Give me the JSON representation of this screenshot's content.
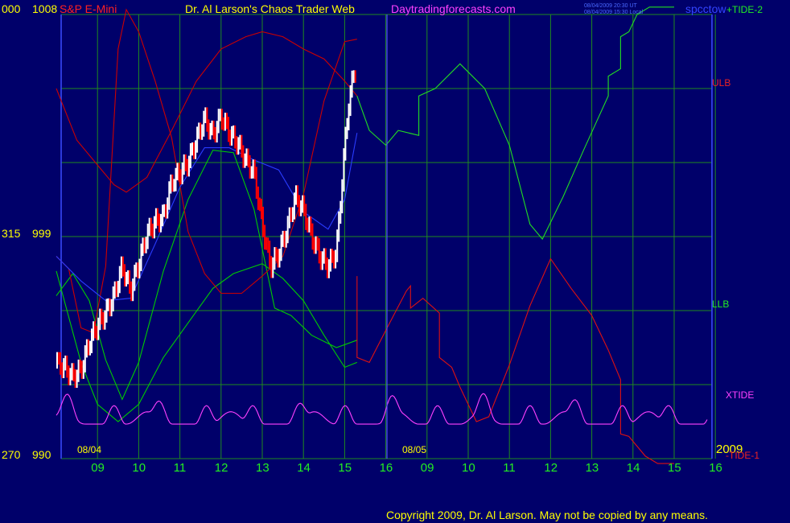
{
  "header": {
    "left_value": "000",
    "top_price": "1008",
    "symbol": "S&P E-Mini",
    "title": "Dr. Al Larson's Chaos Trader Web",
    "site": "Daytradingforecasts.com",
    "timestamp_utc": "08/04/2009 20:30 UT",
    "timestamp_local": "08/04/2009 15:30 Local",
    "ticker": "spcctow"
  },
  "right_labels": {
    "tide2": "+TIDE-2",
    "ulb": "ULB",
    "llb": "LLB",
    "xtide": "XTIDE",
    "year": "2009",
    "tide1": "-TIDE-1"
  },
  "left_labels": {
    "mid_left": "315",
    "mid_price": "999",
    "bottom_left": "270",
    "bottom_price": "990"
  },
  "date_labels": {
    "day1": "08/04",
    "day2": "08/05"
  },
  "footer": {
    "copyright": "Copyright 2009, Dr. Al Larson. May not be copied by any means."
  },
  "colors": {
    "background": "#00006a",
    "grid": "#1f8a1f",
    "price_up": "#ffffff",
    "price_down": "#ff0000",
    "ma_yellow": "#ffff00",
    "ma_blue": "#2a3cff",
    "band_red": "#cc0000",
    "band_green": "#00cc00",
    "xtide": "#ff40ff",
    "tide2": "#22dd22",
    "tide1": "#dd1111",
    "axis_text": "#ffff00",
    "hour_text": "#22ee22",
    "marker": "#5050ff"
  },
  "chart_data": {
    "type": "line",
    "xlabel": "",
    "ylabel": "",
    "y_axis_ticks": [
      990,
      999,
      1008
    ],
    "ylim": [
      990,
      1008
    ],
    "x_hours": [
      "09",
      "10",
      "11",
      "12",
      "13",
      "14",
      "15",
      "16",
      "09",
      "10",
      "11",
      "12",
      "13",
      "14",
      "15",
      "16"
    ],
    "grid": true,
    "price_path": [
      [
        0,
        993.9
      ],
      [
        0.2,
        993.7
      ],
      [
        0.4,
        993.3
      ],
      [
        0.6,
        993.6
      ],
      [
        0.8,
        994.7
      ],
      [
        1.0,
        995.4
      ],
      [
        1.2,
        995.9
      ],
      [
        1.4,
        996.6
      ],
      [
        1.6,
        997.8
      ],
      [
        1.8,
        996.8
      ],
      [
        2.0,
        997.9
      ],
      [
        2.2,
        999.1
      ],
      [
        2.4,
        999.6
      ],
      [
        2.6,
        999.8
      ],
      [
        2.8,
        1001.2
      ],
      [
        3.0,
        1001.6
      ],
      [
        3.2,
        1002.0
      ],
      [
        3.4,
        1002.9
      ],
      [
        3.6,
        1003.8
      ],
      [
        3.8,
        1003.1
      ],
      [
        4.0,
        1003.9
      ],
      [
        4.2,
        1003.2
      ],
      [
        4.4,
        1002.8
      ],
      [
        4.6,
        1002.1
      ],
      [
        4.8,
        1001.6
      ],
      [
        5.0,
        999.5
      ],
      [
        5.2,
        997.8
      ],
      [
        5.4,
        998.3
      ],
      [
        5.6,
        999.3
      ],
      [
        5.8,
        1000.6
      ],
      [
        6.0,
        1000.1
      ],
      [
        6.2,
        999.0
      ],
      [
        6.4,
        998.2
      ],
      [
        6.6,
        997.8
      ],
      [
        6.8,
        998.4
      ],
      [
        6.9,
        1000.4
      ],
      [
        7.0,
        1002.6
      ],
      [
        7.1,
        1004.4
      ],
      [
        7.2,
        1005.4
      ],
      [
        7.3,
        1006.0
      ]
    ],
    "series": [
      {
        "name": "ULB",
        "color": "#cc0000",
        "points": [
          [
            0,
            1005.0
          ],
          [
            0.5,
            1002.9
          ],
          [
            1.0,
            1001.9
          ],
          [
            1.4,
            1001.1
          ],
          [
            1.7,
            1000.8
          ],
          [
            2.2,
            1001.4
          ],
          [
            2.8,
            1003.3
          ],
          [
            3.4,
            1005.3
          ],
          [
            4.0,
            1006.6
          ],
          [
            4.6,
            1007.1
          ],
          [
            5.0,
            1007.3
          ],
          [
            5.5,
            1007.1
          ],
          [
            6.0,
            1006.6
          ],
          [
            6.5,
            1006.2
          ],
          [
            7.0,
            1005.3
          ],
          [
            7.3,
            1004.7
          ]
        ]
      },
      {
        "name": "LLB",
        "color": "#00cc00",
        "points": [
          [
            0,
            997.6
          ],
          [
            0.6,
            993.9
          ],
          [
            1.0,
            992.2
          ],
          [
            1.5,
            991.5
          ],
          [
            2.0,
            992.2
          ],
          [
            2.6,
            994.1
          ],
          [
            3.2,
            995.5
          ],
          [
            3.8,
            996.9
          ],
          [
            4.3,
            997.5
          ],
          [
            5.0,
            997.9
          ],
          [
            5.5,
            997.3
          ],
          [
            6.0,
            996.4
          ],
          [
            6.5,
            995.0
          ],
          [
            7.0,
            993.7
          ],
          [
            7.3,
            993.9
          ]
        ]
      },
      {
        "name": "",
        "color": "#00cc00",
        "points": [
          [
            0,
            996.6
          ],
          [
            0.4,
            997.5
          ],
          [
            0.8,
            996.4
          ],
          [
            1.2,
            994.0
          ],
          [
            1.6,
            992.4
          ],
          [
            2.0,
            993.9
          ],
          [
            2.6,
            997.6
          ],
          [
            3.2,
            1000.5
          ],
          [
            3.8,
            1002.5
          ],
          [
            4.3,
            1002.4
          ],
          [
            4.8,
            1000.1
          ],
          [
            5.3,
            996.1
          ],
          [
            5.7,
            995.8
          ],
          [
            6.2,
            995.0
          ],
          [
            6.8,
            994.5
          ],
          [
            7.3,
            994.8
          ]
        ]
      },
      {
        "name": "",
        "color": "#cc0000",
        "points": [
          [
            0,
            998.2
          ],
          [
            0.3,
            997.7
          ],
          [
            0.6,
            995.3
          ],
          [
            0.9,
            995.1
          ],
          [
            1.2,
            997.8
          ],
          [
            1.5,
            1006.6
          ],
          [
            1.7,
            1008.2
          ],
          [
            2.0,
            1007.3
          ],
          [
            2.4,
            1005.3
          ],
          [
            2.8,
            1003.0
          ],
          [
            3.2,
            999.2
          ],
          [
            3.6,
            997.5
          ],
          [
            4.0,
            996.7
          ],
          [
            4.5,
            996.7
          ],
          [
            5.0,
            997.4
          ],
          [
            5.5,
            998.2
          ],
          [
            6.0,
            1000.7
          ],
          [
            6.5,
            1004.5
          ],
          [
            7.0,
            1006.9
          ],
          [
            7.3,
            1007.0
          ]
        ]
      },
      {
        "name": "",
        "color": "#2a3cff",
        "points": [
          [
            0,
            998.2
          ],
          [
            0.6,
            997.2
          ],
          [
            1.2,
            996.4
          ],
          [
            1.8,
            996.5
          ],
          [
            2.4,
            998.7
          ],
          [
            3.0,
            1001.0
          ],
          [
            3.6,
            1002.6
          ],
          [
            4.2,
            1002.6
          ],
          [
            4.8,
            1002.1
          ],
          [
            5.4,
            1001.7
          ],
          [
            6.0,
            1000.0
          ],
          [
            6.6,
            999.3
          ],
          [
            7.0,
            1000.5
          ],
          [
            7.3,
            1003.2
          ]
        ]
      },
      {
        "name": "+TIDE-2",
        "color": "#22dd22",
        "points": [
          [
            7.3,
            1004.7
          ],
          [
            7.6,
            1003.3
          ],
          [
            8.0,
            1002.7
          ],
          [
            8.3,
            1003.3
          ],
          [
            8.8,
            1003.1
          ],
          [
            8.8,
            1004.7
          ],
          [
            9.2,
            1005.0
          ],
          [
            9.8,
            1006.0
          ],
          [
            10.4,
            1005.0
          ],
          [
            11.0,
            1002.7
          ],
          [
            11.5,
            999.5
          ],
          [
            11.8,
            998.9
          ],
          [
            12.3,
            1000.6
          ],
          [
            12.8,
            1002.5
          ],
          [
            13.4,
            1004.7
          ],
          [
            13.4,
            1005.5
          ],
          [
            13.7,
            1005.8
          ],
          [
            13.7,
            1007.1
          ],
          [
            13.9,
            1007.3
          ],
          [
            14.1,
            1008.0
          ],
          [
            14.4,
            1008.3
          ],
          [
            15.0,
            1008.3
          ]
        ]
      },
      {
        "name": "-TIDE-1",
        "color": "#dd1111",
        "points": [
          [
            7.3,
            997.4
          ],
          [
            7.3,
            994.1
          ],
          [
            7.6,
            993.9
          ],
          [
            8.0,
            995.2
          ],
          [
            8.5,
            996.8
          ],
          [
            8.6,
            997.0
          ],
          [
            8.6,
            996.1
          ],
          [
            8.9,
            996.5
          ],
          [
            9.3,
            995.9
          ],
          [
            9.3,
            994.1
          ],
          [
            9.6,
            993.7
          ],
          [
            9.8,
            992.9
          ],
          [
            10.2,
            991.5
          ],
          [
            10.5,
            991.7
          ],
          [
            11.0,
            993.8
          ],
          [
            11.5,
            996.2
          ],
          [
            12.0,
            998.1
          ],
          [
            12.5,
            996.9
          ],
          [
            13.0,
            995.8
          ],
          [
            13.4,
            994.4
          ],
          [
            13.7,
            993.2
          ],
          [
            13.7,
            991.0
          ],
          [
            13.9,
            990.9
          ],
          [
            14.3,
            990.1
          ],
          [
            14.6,
            989.8
          ],
          [
            15.0,
            989.8
          ]
        ]
      }
    ],
    "xtide": {
      "name": "XTIDE",
      "color": "#ff40ff"
    }
  }
}
